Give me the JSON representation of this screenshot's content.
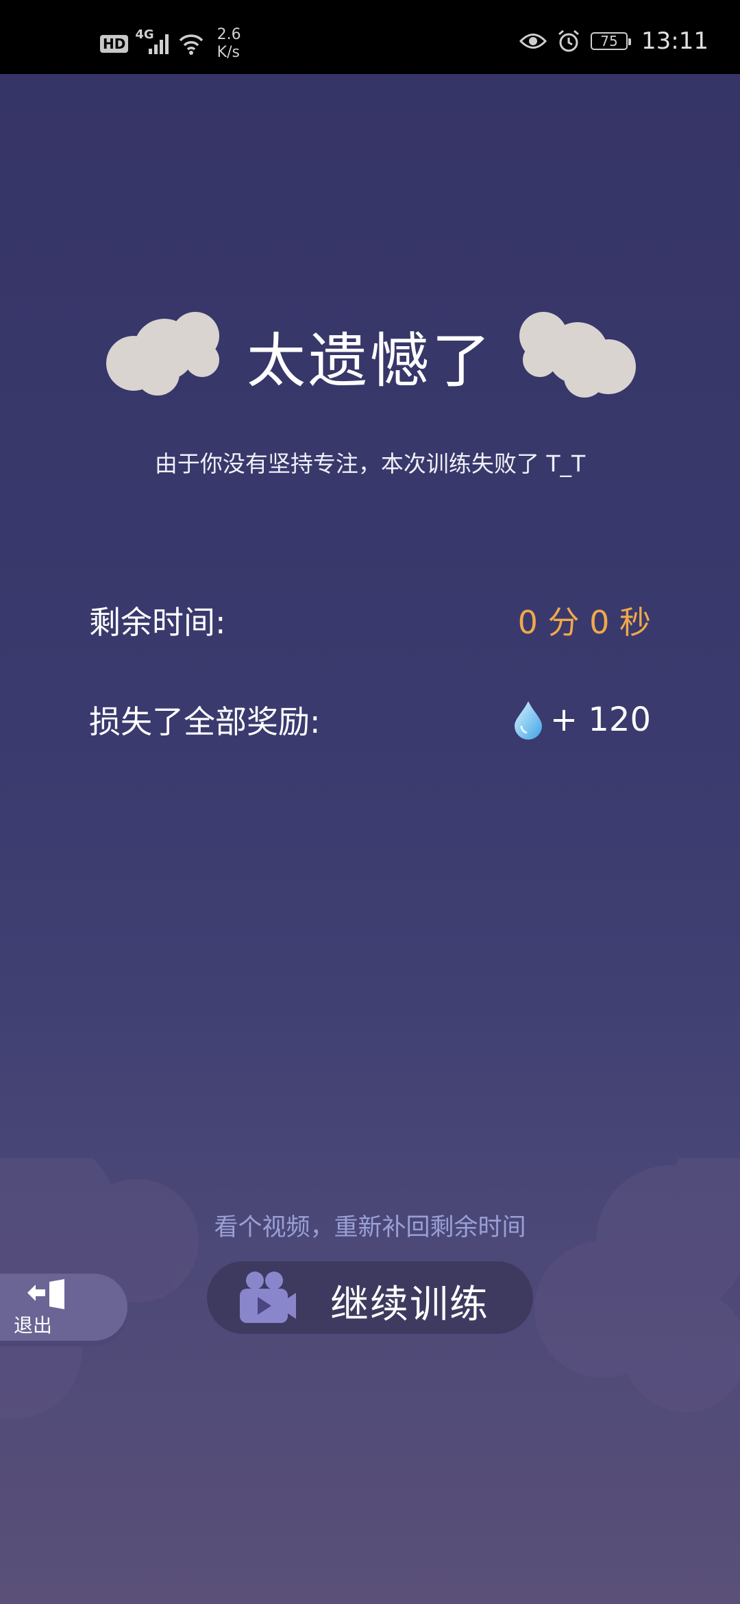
{
  "status_bar": {
    "hd": "HD",
    "network": "4G",
    "speed_value": "2.6",
    "speed_unit": "K/s",
    "battery": "75",
    "time": "13:11"
  },
  "title": "太遗憾了",
  "subtitle": "由于你没有坚持专注，本次训练失败了 T_T",
  "remaining": {
    "label": "剩余时间:",
    "value": "0 分 0 秒"
  },
  "loss": {
    "label": "损失了全部奖励:",
    "value": "+ 120",
    "icon": "water-drop-icon"
  },
  "hint": "看个视频，重新补回剩余时间",
  "exit_button": {
    "label": "退出"
  },
  "continue_button": {
    "label": "继续训练"
  },
  "colors": {
    "background": "#3a3a6e",
    "accent_orange": "#f0a84a",
    "hint": "#9aa0d6"
  }
}
